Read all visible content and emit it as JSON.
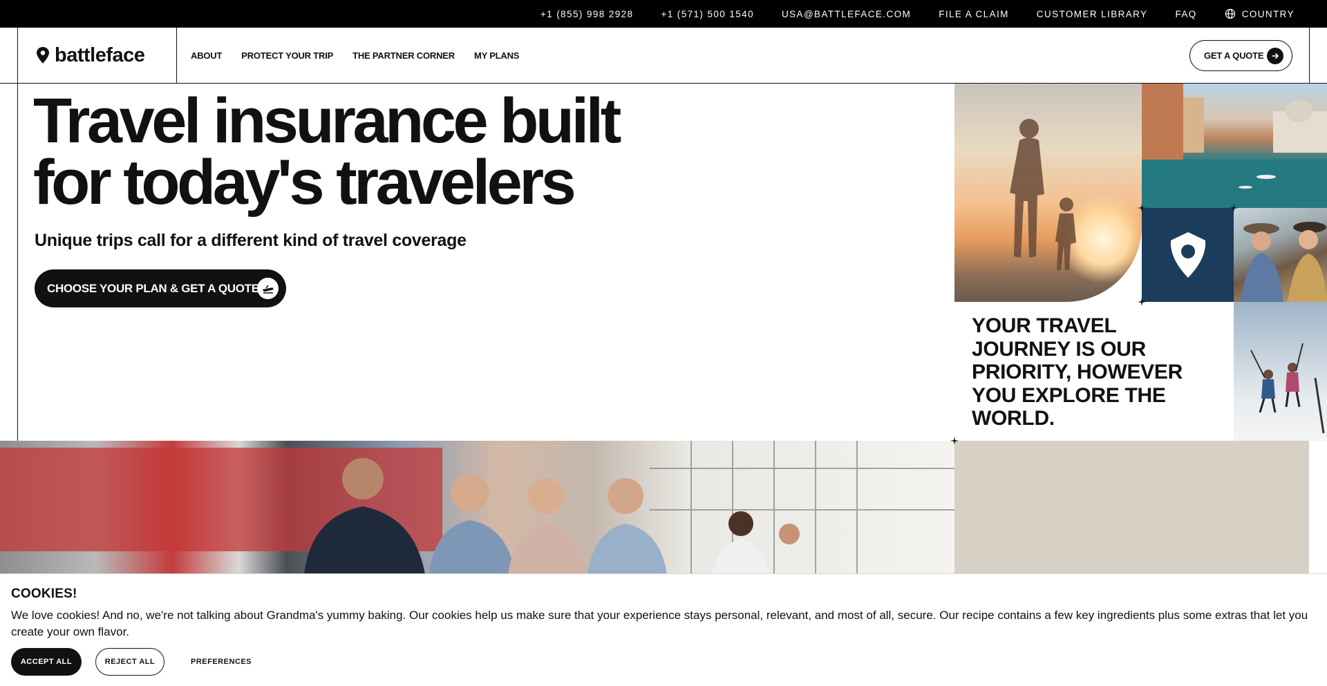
{
  "topbar": {
    "phone1": "+1 (855) 998 2928",
    "phone2": "+1 (571) 500 1540",
    "email": "USA@BATTLEFACE.COM",
    "file_claim": "FILE A CLAIM",
    "customer_library": "CUSTOMER LIBRARY",
    "faq": "FAQ",
    "country": "COUNTRY",
    "country_icon": "globe-icon"
  },
  "nav": {
    "logo_text": "battleface",
    "links": [
      "ABOUT",
      "PROTECT YOUR TRIP",
      "THE PARTNER CORNER",
      "MY PLANS"
    ],
    "quote_label": "GET A QUOTE"
  },
  "hero": {
    "title_line1": "Travel insurance built",
    "title_line2": "for today's travelers",
    "subtitle": "Unique trips call for a different kind of travel coverage",
    "cta_label": "CHOOSE YOUR PLAN & GET A QUOTE"
  },
  "mosaic": {
    "tagline": "YOUR TRAVEL JOURNEY IS OUR PRIORITY, HOWEVER YOU EXPLORE THE WORLD.",
    "pin_color": "#1b3c5a",
    "beige_color": "#d6d0c5"
  },
  "cookies": {
    "title": "COOKIES!",
    "message": "We love cookies! And no, we're not talking about Grandma's yummy baking. Our cookies help us make sure that your experience stays personal, relevant, and most of all, secure. Our recipe contains a few key ingredients plus some extras that let you create your own flavor.",
    "accept": "ACCEPT ALL",
    "reject": "REJECT ALL",
    "preferences": "PREFERENCES"
  }
}
